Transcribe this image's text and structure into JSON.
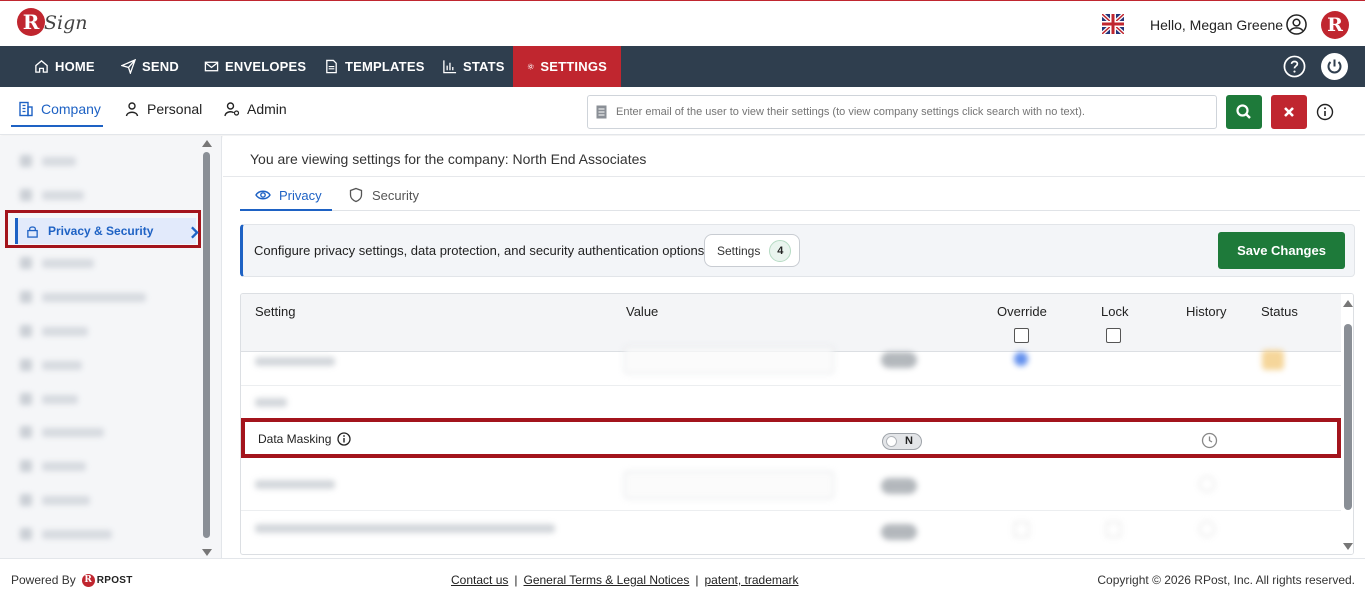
{
  "header": {
    "logo_letter": "R",
    "logo_text": "Sign",
    "greeting": "Hello, Megan Greene",
    "brand_letter": "R"
  },
  "nav": {
    "items": [
      {
        "label": "HOME",
        "icon": "home-icon"
      },
      {
        "label": "SEND",
        "icon": "send-icon"
      },
      {
        "label": "ENVELOPES",
        "icon": "envelope-icon"
      },
      {
        "label": "TEMPLATES",
        "icon": "document-icon"
      },
      {
        "label": "STATS",
        "icon": "bar-chart-icon"
      },
      {
        "label": "SETTINGS",
        "icon": "gear-icon",
        "active": true
      }
    ],
    "active_color": "#c0262f",
    "bar_color": "#2f3e4e"
  },
  "subtabs": {
    "company": "Company",
    "personal": "Personal",
    "admin": "Admin"
  },
  "search": {
    "placeholder": "Enter email of the user to view their settings (to view company settings click search with no text)."
  },
  "sidebar": {
    "active_item": "Privacy & Security"
  },
  "main": {
    "viewing": "You are viewing settings for the company: North End Associates",
    "tabs": {
      "privacy": "Privacy",
      "security": "Security"
    },
    "config_text": "Configure privacy settings, data protection, and security authentication options.",
    "settings_label": "Settings",
    "settings_count": "4",
    "save_label": "Save Changes"
  },
  "table": {
    "columns": {
      "setting": "Setting",
      "value": "Value",
      "override": "Override",
      "lock": "Lock",
      "history": "History",
      "status": "Status"
    },
    "data_masking": {
      "label": "Data Masking",
      "toggle_text": "N"
    }
  },
  "footer": {
    "powered_by": "Powered By",
    "rpost_text": "RPOST",
    "contact": "Contact us",
    "terms": "General Terms & Legal Notices",
    "patent": "patent, trademark",
    "copyright": "Copyright © 2026 RPost, Inc. All rights reserved."
  }
}
